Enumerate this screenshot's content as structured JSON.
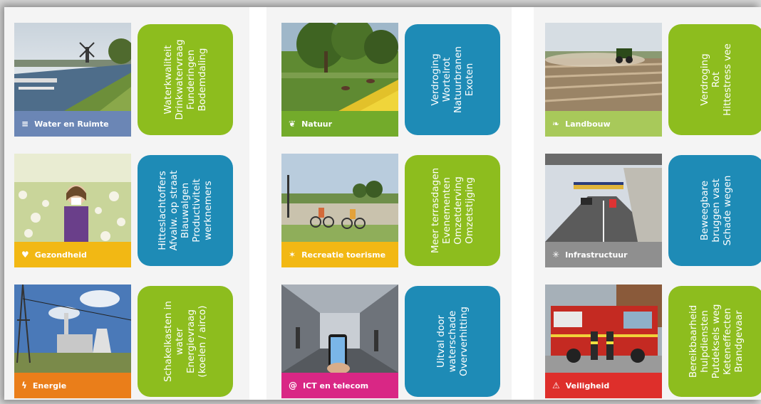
{
  "colors": {
    "green_card": "#8dbd1e",
    "blue_card": "#1e8bb6",
    "water": "#6b86b5",
    "natuur": "#73ab2b",
    "landbouw": "#a8c95a",
    "gezondheid": "#f2b814",
    "recreatie": "#f2b814",
    "infrastructuur": "#8f8f8f",
    "energie": "#ea7e1a",
    "ict": "#d92785",
    "veiligheid": "#de2f2b"
  },
  "sectors": [
    {
      "name": "Water en Ruimte",
      "icon": "menu-lines-icon",
      "glyph": "≡",
      "card_color": "green",
      "lines": [
        "Waterkwaliteit",
        "Drinkwatervraag",
        "Funderingen",
        "Bodemdaling"
      ]
    },
    {
      "name": "Natuur",
      "icon": "flower-icon",
      "glyph": "❦",
      "card_color": "blue",
      "lines": [
        "Verdroging",
        "Wortelrot",
        "Natuurbranen",
        "Exoten"
      ]
    },
    {
      "name": "Landbouw",
      "icon": "leaf-icon",
      "glyph": "❧",
      "card_color": "green",
      "lines": [
        "Verdroging",
        "Rot",
        "Hittestress vee"
      ]
    },
    {
      "name": "Gezondheid",
      "icon": "heart-icon",
      "glyph": "♥",
      "card_color": "blue",
      "lines": [
        "Hitteslachtoffers",
        "Afvalw. op straat",
        "Blauwalgen",
        "Productiviteit",
        "werknemers"
      ]
    },
    {
      "name": "Recreatie toerisme",
      "icon": "runner-icon",
      "glyph": "✶",
      "card_color": "green",
      "lines": [
        "Meer terrasdagen",
        "Evenementen",
        "Omzetderving",
        "Omzetstijging"
      ]
    },
    {
      "name": "Infrastructuur",
      "icon": "junction-icon",
      "glyph": "✳",
      "card_color": "blue",
      "lines": [
        "Beweegbare",
        "bruggen vast",
        "Schade wegen"
      ]
    },
    {
      "name": "Energie",
      "icon": "lightning-icon",
      "glyph": "ϟ",
      "card_color": "green",
      "lines": [
        "Schakelkasten in",
        "water",
        "Energievraag",
        "(koelen / airco)"
      ]
    },
    {
      "name": "ICT en telecom",
      "icon": "at-sign-icon",
      "glyph": "@",
      "card_color": "blue",
      "lines": [
        "Uitval door",
        "waterschade",
        "Oververhitting"
      ]
    },
    {
      "name": "Veiligheid",
      "icon": "warning-icon",
      "glyph": "⚠",
      "card_color": "green",
      "lines": [
        "Bereikbaarheid",
        "hulpdiensten",
        "Putdeksels weg",
        "Keteneffecten",
        "Brandgevaar"
      ]
    }
  ]
}
